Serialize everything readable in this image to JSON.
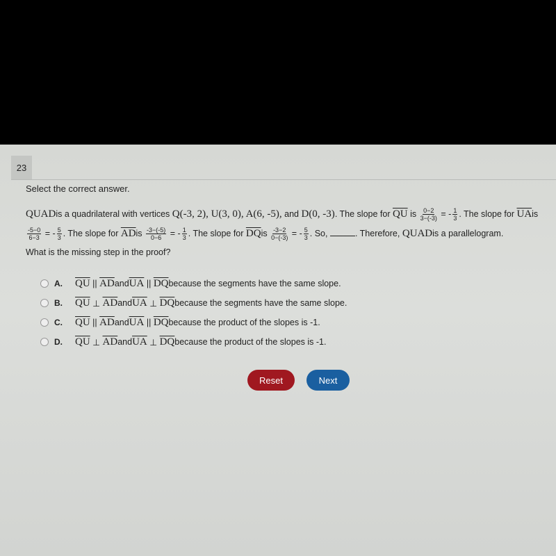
{
  "question_number": "23",
  "instruction": "Select the correct answer.",
  "stem": {
    "quad": "QUAD",
    "t1": "is a quadrilateral with vertices ",
    "vertices": "Q(-3, 2), U(3, 0), A(6, -5),",
    "and": " and ",
    "vertex_d": "D(0, -3)",
    "t2": ". The slope for ",
    "qu": "QU",
    "is": " is ",
    "qu_num": "0−2",
    "qu_den": "3−(-3)",
    "eq": " = -",
    "one": "1",
    "three": "3",
    "t3": ". The slope for ",
    "ua": "UA",
    "is2": "is ",
    "ua_num": "-5−0",
    "ua_den": "6−3",
    "five": "5",
    "t4": ". The slope for ",
    "ad": "AD",
    "ad_num": "-3−(-5)",
    "ad_den": "0−6",
    "t5": ". The slope for ",
    "dq": "DQ",
    "dq_num": "-3−2",
    "dq_den": "0−(-3)",
    "so": ". So, ",
    "t6": ". Therefore, ",
    "t7": "is a parallelogram."
  },
  "question": "What is the missing step in the proof?",
  "options": [
    {
      "letter": "A.",
      "rel": "||",
      "reason": "because the segments have the same slope."
    },
    {
      "letter": "B.",
      "rel": "⊥",
      "reason": "because the segments have the same slope."
    },
    {
      "letter": "C.",
      "rel": "||",
      "reason": "because the product of the slopes is -1."
    },
    {
      "letter": "D.",
      "rel": "⊥",
      "reason": "because the product of the slopes is -1."
    }
  ],
  "seg": {
    "qu": "QU",
    "ad": "AD",
    "ua": "UA",
    "dq": "DQ",
    "and": "and "
  },
  "buttons": {
    "reset": "Reset",
    "next": "Next"
  }
}
